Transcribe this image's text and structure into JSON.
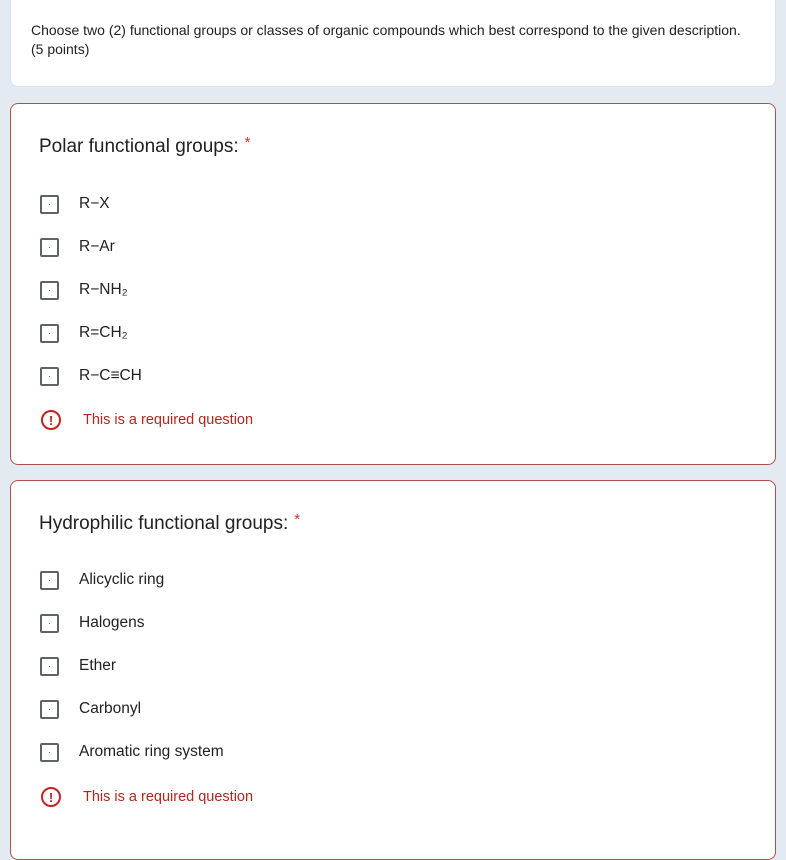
{
  "intro": {
    "description": "Choose two (2) functional groups or classes of organic compounds which best correspond to the given description. (5 points)"
  },
  "questions": [
    {
      "title": "Polar functional groups:",
      "required_marker": "*",
      "options": [
        {
          "label": "R−X",
          "checked": false
        },
        {
          "label": "R−Ar",
          "checked": false
        },
        {
          "label": "R−NH₂",
          "checked": false
        },
        {
          "label": "R=CH₂",
          "checked": false
        },
        {
          "label": "R−C≡CH",
          "checked": false
        }
      ],
      "error": {
        "icon": "error-exclamation-icon",
        "glyph": "!",
        "text": "This is a required question"
      }
    },
    {
      "title": "Hydrophilic functional groups:",
      "required_marker": "*",
      "options": [
        {
          "label": "Alicyclic ring",
          "checked": false
        },
        {
          "label": "Halogens",
          "checked": false
        },
        {
          "label": "Ether",
          "checked": false
        },
        {
          "label": "Carbonyl",
          "checked": false
        },
        {
          "label": "Aromatic ring system",
          "checked": false
        }
      ],
      "error": {
        "icon": "error-exclamation-icon",
        "glyph": "!",
        "text": "This is a required question"
      }
    }
  ],
  "checkbox_glyph": "·",
  "colors": {
    "background": "#e3eaf2",
    "error": "#c5221f",
    "required": "#d93025",
    "card_error_border": "#b0504c"
  }
}
